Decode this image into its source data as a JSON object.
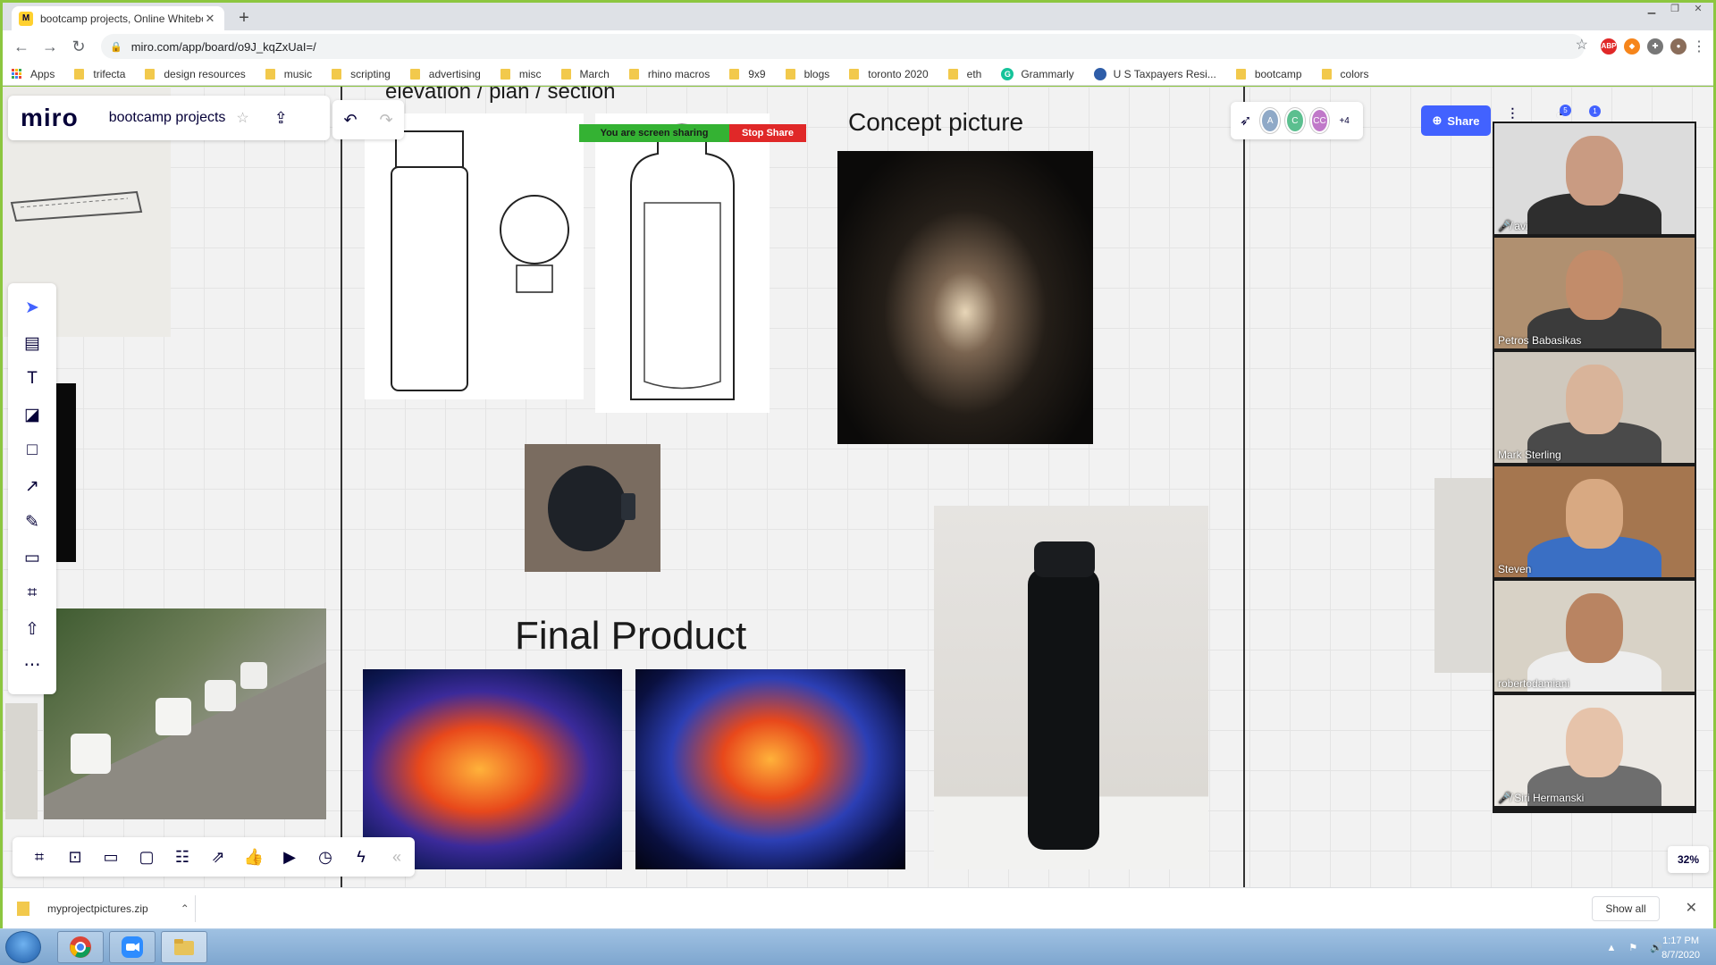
{
  "browser": {
    "tab_title": "bootcamp projects, Online Whiteboard",
    "url": "miro.com/app/board/o9J_kqZxUaI=/",
    "bookmarks": [
      "Apps",
      "trifecta",
      "design resources",
      "music",
      "scripting",
      "advertising",
      "misc",
      "March",
      "rhino macros",
      "9x9",
      "blogs",
      "toronto 2020",
      "eth",
      "Grammarly",
      "U S Taxpayers Resi...",
      "bootcamp",
      "colors"
    ],
    "extensions": [
      "ABP",
      "metamask",
      "puzzle",
      "profile"
    ]
  },
  "miro": {
    "logo": "miro",
    "board_name": "bootcamp projects",
    "share_label": "Share",
    "zoom_level": "32%",
    "collaborators": [
      {
        "initials": "A",
        "color": "#8fa9c7"
      },
      {
        "initials": "C",
        "color": "#5bbf8f"
      },
      {
        "initials": "CC",
        "color": "#c079c9"
      }
    ],
    "collaborators_more": "+4",
    "notification_badges": [
      "5",
      "1"
    ]
  },
  "board": {
    "elevation_title": "elevation / plan / section",
    "concept_title": "Concept picture",
    "final_title": "Final Product"
  },
  "zoom_bar": {
    "sharing_text": "You are screen sharing",
    "stop_label": "Stop Share"
  },
  "participants": [
    {
      "name": "avi",
      "muted": true,
      "bg": "#dcdcdc",
      "skin": "#c99b82",
      "shirt": "#2e2e2e"
    },
    {
      "name": "Petros Babasikas",
      "muted": false,
      "bg": "#b09070",
      "skin": "#c28c6a",
      "shirt": "#3b3b3b"
    },
    {
      "name": "Mark Sterling",
      "muted": false,
      "bg": "#cfc8bd",
      "skin": "#d9b49a",
      "shirt": "#4a4a4a"
    },
    {
      "name": "Steven",
      "muted": false,
      "bg": "#a5764f",
      "skin": "#d8a982",
      "shirt": "#3a6fc4"
    },
    {
      "name": "robertodamiani",
      "muted": false,
      "bg": "#d8d2c6",
      "skin": "#b98462",
      "shirt": "#eeeeee"
    },
    {
      "name": "Siri Hermanski",
      "muted": true,
      "bg": "#ece9e4",
      "skin": "#e6c3aa",
      "shirt": "#6e6e6e"
    }
  ],
  "downloads": {
    "file_name": "myprojectpictures.zip",
    "show_all_label": "Show all"
  },
  "taskbar": {
    "time": "1:17 PM",
    "date": "8/7/2020"
  }
}
